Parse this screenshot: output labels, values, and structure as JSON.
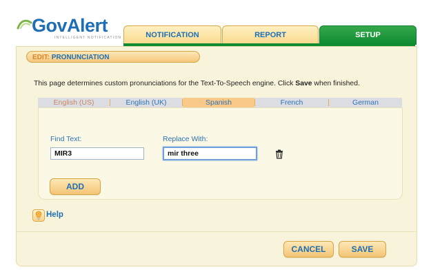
{
  "logo": {
    "name": "GovAlert",
    "tagline": "INTELLIGENT NOTIFICATION"
  },
  "tabs": [
    {
      "label": "NOTIFICATION"
    },
    {
      "label": "REPORT"
    },
    {
      "label": "SETUP"
    }
  ],
  "page": {
    "title_prefix": "EDIT:",
    "title": "PRONUNCIATION",
    "intro_before": "This page determines custom pronunciations for the Text-To-Speech engine. Click ",
    "intro_bold": "Save",
    "intro_after": " when finished."
  },
  "languages": [
    {
      "label": "English (US)"
    },
    {
      "label": "English (UK)"
    },
    {
      "label": "Spanish"
    },
    {
      "label": "French"
    },
    {
      "label": "German"
    }
  ],
  "form": {
    "find_label": "Find Text:",
    "find_value": "MIR3",
    "replace_label": "Replace With:",
    "replace_value": "mir three",
    "add_label": "ADD"
  },
  "help": {
    "label": "Help"
  },
  "footer": {
    "cancel_label": "CANCEL",
    "save_label": "SAVE"
  },
  "colors": {
    "accent": "#1e6fb3",
    "setup_tab": "#0e8a30",
    "panel_bg": "#f8f4dc",
    "button_bg": "#f4c576"
  }
}
